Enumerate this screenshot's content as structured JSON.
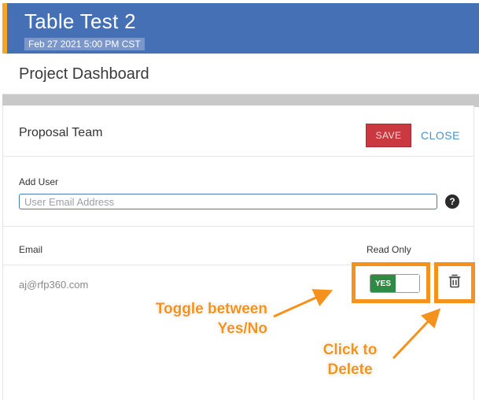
{
  "header": {
    "title": "Table Test 2",
    "date": "Feb 27 2021 5:00 PM CST"
  },
  "subheader": {
    "title": "Project Dashboard"
  },
  "panel": {
    "title": "Proposal Team",
    "save_label": "SAVE",
    "close_label": "CLOSE",
    "add_user_label": "Add User",
    "email_placeholder": "User Email Address",
    "help_icon": "question-circle-icon",
    "columns": {
      "email": "Email",
      "read_only": "Read Only"
    },
    "rows": [
      {
        "email": "aj@rfp360.com",
        "read_only": "YES",
        "delete_icon": "trash-icon"
      }
    ]
  },
  "annotations": {
    "toggle_callout_line1": "Toggle between",
    "toggle_callout_line2": "Yes/No",
    "delete_callout_line1": "Click to",
    "delete_callout_line2": "Delete"
  },
  "colors": {
    "header_bg": "#4670b6",
    "accent_orange": "#f5921e",
    "save_red": "#c9393f",
    "toggle_green": "#2e8b43",
    "link_blue": "#4a90c9"
  }
}
